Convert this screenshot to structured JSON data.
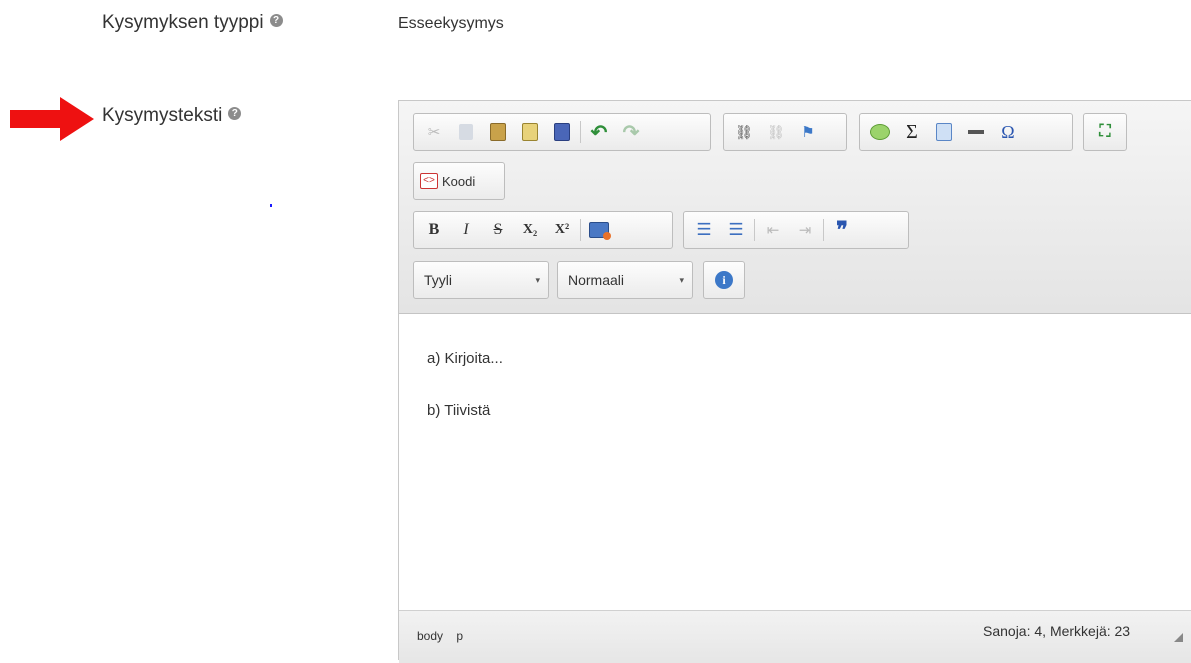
{
  "form": {
    "question_type_label": "Kysymyksen tyyppi",
    "question_type_value": "Esseekysymys",
    "question_text_label": "Kysymysteksti",
    "help_glyph": "?"
  },
  "editor": {
    "toolbar_row1": [
      {
        "name": "cut-icon",
        "glyph": "✂",
        "enabled": false
      },
      {
        "name": "copy-icon",
        "glyph": "⧉",
        "enabled": false
      },
      {
        "name": "paste-icon",
        "glyph": "📋",
        "enabled": true
      },
      {
        "name": "paste-text-icon",
        "glyph": "▤",
        "enabled": true
      },
      {
        "name": "paste-word-icon",
        "glyph": "▦",
        "enabled": true
      },
      {
        "name": "undo-icon",
        "glyph": "↶",
        "enabled": true
      },
      {
        "name": "redo-icon",
        "glyph": "↷",
        "enabled": false
      },
      {
        "name": "link-icon",
        "glyph": "⛓",
        "enabled": true
      },
      {
        "name": "unlink-icon",
        "glyph": "⛓",
        "enabled": false
      },
      {
        "name": "anchor-icon",
        "glyph": "⚑",
        "enabled": true
      },
      {
        "name": "comment-icon",
        "glyph": "💬",
        "enabled": true
      },
      {
        "name": "sigma-icon",
        "glyph": "Σ",
        "enabled": true
      },
      {
        "name": "table-icon",
        "glyph": "▦",
        "enabled": true
      },
      {
        "name": "horizontal-rule-icon",
        "glyph": "▬",
        "enabled": true
      },
      {
        "name": "special-char-icon",
        "glyph": "Ω",
        "enabled": true
      },
      {
        "name": "maximize-icon",
        "glyph": "⛶",
        "enabled": true
      }
    ],
    "source_button_label": "Koodi",
    "source_glyph": "<>",
    "toolbar_row3": {
      "bold": "B",
      "italic": "I",
      "strike": "S",
      "subscript": "X₂",
      "superscript": "X²",
      "image": "▣",
      "ordered_list": "☰",
      "bullet_list": "☰",
      "outdent": "⇤",
      "indent": "⇥",
      "blockquote": "❞"
    },
    "style_select": "Tyyli",
    "format_select": "Normaali",
    "info_glyph": "i",
    "dropdown_caret": "▾",
    "content_lines": [
      "a) Kirjoita...",
      "b) Tiivistä"
    ],
    "status_path": [
      "body",
      "p"
    ],
    "word_count": "Sanoja: 4, Merkkejä: 23"
  },
  "colors": {
    "arrow": "#ee1111",
    "info": "#3c78c8",
    "link": "#3a3a3a"
  }
}
